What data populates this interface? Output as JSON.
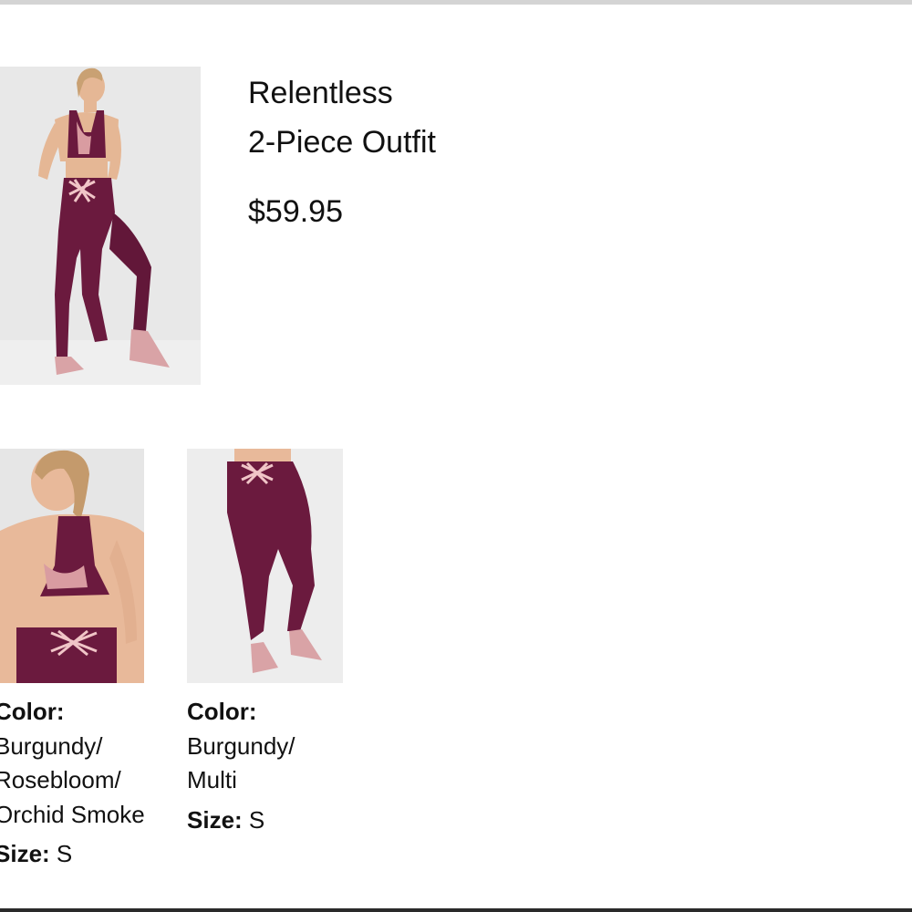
{
  "product": {
    "title_line_1": "Relentless",
    "title_line_2": "2-Piece Outfit",
    "price": "$59.95",
    "main_image_alt": "Model wearing burgundy sports bra and leggings, back view"
  },
  "items": [
    {
      "image_alt": "Back view of burgundy racerback sports bra with rosebloom lining",
      "color_label": "Color:",
      "color_lines": [
        "Burgundy/",
        "Rosebloom/",
        "Orchid Smoke"
      ],
      "size_label": "Size:",
      "size_value": " S"
    },
    {
      "image_alt": "Back view of burgundy leggings with crisscross waistband",
      "color_label": "Color:",
      "color_lines": [
        "Burgundy/",
        "Multi"
      ],
      "size_label": "Size:",
      "size_value": " S"
    }
  ],
  "colors": {
    "burgundy": "#6b1a3e",
    "rosebloom": "#e3a9ad",
    "photo_background": "#e9e9e9",
    "skin": "#e8b99a"
  }
}
